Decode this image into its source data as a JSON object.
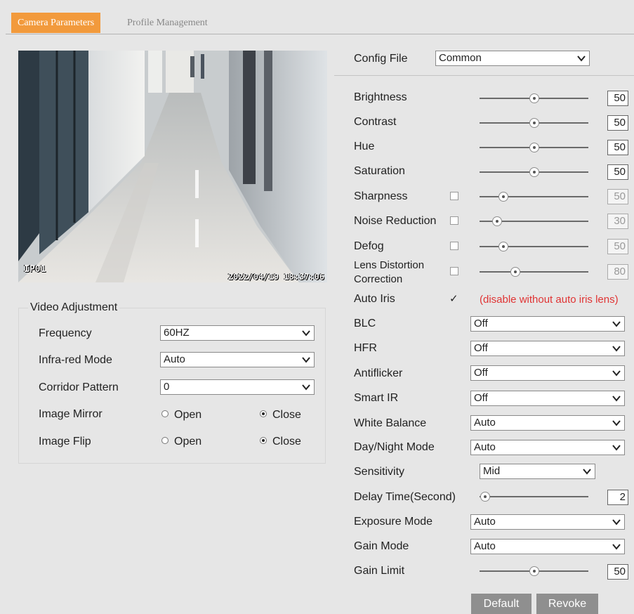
{
  "tabs": {
    "camera_parameters": "Camera Parameters",
    "profile_management": "Profile Management"
  },
  "preview": {
    "osd_name": "IP01",
    "osd_time": "2022/04/19 18:37:06"
  },
  "video_adjustment": {
    "title": "Video Adjustment",
    "frequency_label": "Frequency",
    "frequency_value": "60HZ",
    "infrared_label": "Infra-red Mode",
    "infrared_value": "Auto",
    "corridor_label": "Corridor Pattern",
    "corridor_value": "0",
    "mirror_label": "Image Mirror",
    "flip_label": "Image Flip",
    "open_label": "Open",
    "close_label": "Close",
    "mirror_selected": "Close",
    "flip_selected": "Close"
  },
  "config": {
    "label": "Config File",
    "value": "Common"
  },
  "sliders": {
    "brightness": {
      "label": "Brightness",
      "value": "50",
      "level": 50,
      "enabled": true
    },
    "contrast": {
      "label": "Contrast",
      "value": "50",
      "level": 50,
      "enabled": true
    },
    "hue": {
      "label": "Hue",
      "value": "50",
      "level": 50,
      "enabled": true
    },
    "saturation": {
      "label": "Saturation",
      "value": "50",
      "level": 50,
      "enabled": true
    },
    "sharpness": {
      "label": "Sharpness",
      "value": "50",
      "level": 22,
      "enabled": false
    },
    "noise_reduction": {
      "label": "Noise Reduction",
      "value": "30",
      "level": 16,
      "enabled": false
    },
    "defog": {
      "label": "Defog",
      "value": "50",
      "level": 22,
      "enabled": false
    },
    "lens_distortion": {
      "label_line1": "Lens Distortion",
      "label_line2": "Correction",
      "value": "80",
      "level": 33,
      "enabled": false
    },
    "delay_time": {
      "label": "Delay Time(Second)",
      "value": "2",
      "level": 5,
      "enabled": true
    },
    "gain_limit": {
      "label": "Gain Limit",
      "value": "50",
      "level": 50,
      "enabled": true
    }
  },
  "auto_iris": {
    "label": "Auto Iris",
    "checked": true,
    "note": "(disable without auto iris lens)"
  },
  "selects": {
    "blc": {
      "label": "BLC",
      "value": "Off"
    },
    "hfr": {
      "label": "HFR",
      "value": "Off"
    },
    "antiflicker": {
      "label": "Antiflicker",
      "value": "Off"
    },
    "smart_ir": {
      "label": "Smart IR",
      "value": "Off"
    },
    "white_balance": {
      "label": "White Balance",
      "value": "Auto"
    },
    "day_night": {
      "label": "Day/Night Mode",
      "value": "Auto"
    },
    "sensitivity": {
      "label": "Sensitivity",
      "value": "Mid"
    },
    "exposure_mode": {
      "label": "Exposure Mode",
      "value": "Auto"
    },
    "gain_mode": {
      "label": "Gain Mode",
      "value": "Auto"
    }
  },
  "buttons": {
    "default": "Default",
    "revoke": "Revoke"
  },
  "colors": {
    "accent": "#f29a3c",
    "warning": "#e03434",
    "button": "#8f8f8f",
    "background": "#e6e6e6"
  }
}
